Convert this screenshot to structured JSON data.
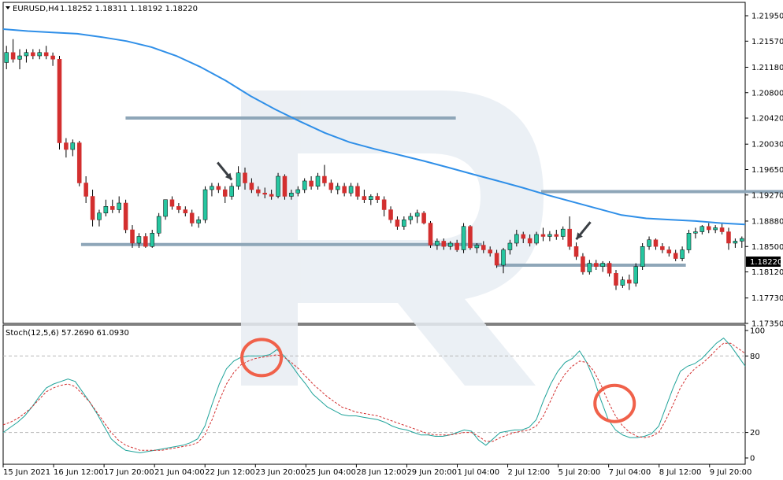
{
  "header": {
    "dropdown_icon": "triangle-down-icon",
    "symbol": "EURUSD,H4",
    "ohlc": "1.18252 1.18311 1.18192 1.18220"
  },
  "indicator_header": "Stoch(12,5,6) 57.2690 61.0930",
  "current_price_label": "1.18220",
  "colors": {
    "bull": "#26c6a0",
    "bear": "#d32f2f",
    "ma": "#2f8fe8",
    "level_line": "#8ea6b8",
    "stoch_main": "#1fa39a",
    "stoch_signal": "#d32f2f",
    "circle": "#f0614a",
    "arrow": "#3a3f44",
    "price_box": "#000000"
  },
  "chart_data": [
    {
      "type": "candlestick",
      "symbol": "EURUSD",
      "timeframe": "H4",
      "ylim": [
        1.1735,
        1.2215
      ],
      "y_ticks": [
        "1.21950",
        "1.21570",
        "1.21180",
        "1.20800",
        "1.20420",
        "1.20030",
        "1.19650",
        "1.19270",
        "1.18880",
        "1.18500",
        "1.18120",
        "1.17730",
        "1.17350"
      ],
      "x_ticks": [
        "15 Jun 2021",
        "16 Jun 12:00",
        "17 Jun 20:00",
        "21 Jun 04:00",
        "22 Jun 12:00",
        "23 Jun 20:00",
        "25 Jun 04:00",
        "28 Jun 12:00",
        "29 Jun 20:00",
        "1 Jul 04:00",
        "2 Jul 12:00",
        "5 Jul 20:00",
        "7 Jul 04:00",
        "8 Jul 12:00",
        "9 Jul 20:00"
      ],
      "candles": [
        [
          1.2125,
          1.215,
          1.2115,
          1.214
        ],
        [
          1.214,
          1.216,
          1.2125,
          1.213
        ],
        [
          1.213,
          1.2145,
          1.2115,
          1.2135
        ],
        [
          1.2135,
          1.2145,
          1.2125,
          1.214
        ],
        [
          1.214,
          1.2145,
          1.213,
          1.2135
        ],
        [
          1.2135,
          1.2145,
          1.213,
          1.214
        ],
        [
          1.214,
          1.215,
          1.213,
          1.2135
        ],
        [
          1.2135,
          1.214,
          1.212,
          1.213
        ],
        [
          1.213,
          1.2135,
          1.1995,
          1.2005
        ],
        [
          1.2005,
          1.2012,
          1.1983,
          1.1995
        ],
        [
          1.1995,
          1.201,
          1.1985,
          1.2005
        ],
        [
          1.2005,
          1.2008,
          1.194,
          1.1945
        ],
        [
          1.1945,
          1.1955,
          1.1915,
          1.1925
        ],
        [
          1.1925,
          1.1935,
          1.188,
          1.189
        ],
        [
          1.189,
          1.1905,
          1.188,
          1.19
        ],
        [
          1.19,
          1.192,
          1.1895,
          1.191
        ],
        [
          1.191,
          1.192,
          1.19,
          1.1905
        ],
        [
          1.1905,
          1.1925,
          1.19,
          1.1915
        ],
        [
          1.1915,
          1.192,
          1.187,
          1.1875
        ],
        [
          1.1875,
          1.1882,
          1.1848,
          1.1855
        ],
        [
          1.1855,
          1.187,
          1.1848,
          1.1865
        ],
        [
          1.1865,
          1.187,
          1.1848,
          1.185
        ],
        [
          1.185,
          1.1875,
          1.1848,
          1.187
        ],
        [
          1.187,
          1.19,
          1.1865,
          1.1895
        ],
        [
          1.1895,
          1.192,
          1.189,
          1.192
        ],
        [
          1.192,
          1.1925,
          1.1905,
          1.191
        ],
        [
          1.191,
          1.1915,
          1.19,
          1.1905
        ],
        [
          1.1905,
          1.191,
          1.1895,
          1.19
        ],
        [
          1.19,
          1.1905,
          1.188,
          1.1885
        ],
        [
          1.1885,
          1.1895,
          1.1878,
          1.189
        ],
        [
          1.189,
          1.194,
          1.1885,
          1.1935
        ],
        [
          1.1935,
          1.1945,
          1.1925,
          1.194
        ],
        [
          1.194,
          1.1945,
          1.193,
          1.1935
        ],
        [
          1.1935,
          1.194,
          1.1915,
          1.1925
        ],
        [
          1.1925,
          1.1945,
          1.192,
          1.194
        ],
        [
          1.194,
          1.197,
          1.1935,
          1.196
        ],
        [
          1.196,
          1.1968,
          1.1935,
          1.1945
        ],
        [
          1.1945,
          1.1952,
          1.193,
          1.1935
        ],
        [
          1.1935,
          1.194,
          1.1925,
          1.193
        ],
        [
          1.193,
          1.1938,
          1.1922,
          1.1928
        ],
        [
          1.1928,
          1.1935,
          1.192,
          1.1925
        ],
        [
          1.1925,
          1.196,
          1.1922,
          1.1955
        ],
        [
          1.1955,
          1.1958,
          1.192,
          1.1925
        ],
        [
          1.1925,
          1.1935,
          1.192,
          1.193
        ],
        [
          1.193,
          1.194,
          1.1925,
          1.1935
        ],
        [
          1.1935,
          1.1952,
          1.193,
          1.1948
        ],
        [
          1.1948,
          1.1955,
          1.1935,
          1.194
        ],
        [
          1.194,
          1.196,
          1.1935,
          1.1955
        ],
        [
          1.1955,
          1.1972,
          1.194,
          1.1945
        ],
        [
          1.1945,
          1.195,
          1.193,
          1.1935
        ],
        [
          1.1935,
          1.1945,
          1.1928,
          1.194
        ],
        [
          1.194,
          1.1945,
          1.1925,
          1.193
        ],
        [
          1.193,
          1.1945,
          1.1925,
          1.194
        ],
        [
          1.194,
          1.1945,
          1.192,
          1.1925
        ],
        [
          1.1925,
          1.1935,
          1.1915,
          1.192
        ],
        [
          1.192,
          1.1928,
          1.1912,
          1.1925
        ],
        [
          1.1925,
          1.193,
          1.1915,
          1.192
        ],
        [
          1.192,
          1.1925,
          1.1895,
          1.1905
        ],
        [
          1.1905,
          1.191,
          1.1885,
          1.189
        ],
        [
          1.189,
          1.1895,
          1.1875,
          1.188
        ],
        [
          1.188,
          1.1895,
          1.1875,
          1.189
        ],
        [
          1.189,
          1.19,
          1.1883,
          1.1895
        ],
        [
          1.1895,
          1.1905,
          1.1885,
          1.19
        ],
        [
          1.19,
          1.1903,
          1.1883,
          1.1885
        ],
        [
          1.1885,
          1.1888,
          1.1848,
          1.1852
        ],
        [
          1.1852,
          1.1862,
          1.1845,
          1.1858
        ],
        [
          1.1858,
          1.1862,
          1.1845,
          1.185
        ],
        [
          1.185,
          1.1858,
          1.1845,
          1.1855
        ],
        [
          1.1855,
          1.186,
          1.1842,
          1.1845
        ],
        [
          1.1845,
          1.1885,
          1.184,
          1.188
        ],
        [
          1.188,
          1.1882,
          1.1845,
          1.1848
        ],
        [
          1.1848,
          1.1855,
          1.184,
          1.1852
        ],
        [
          1.1852,
          1.1858,
          1.184,
          1.1845
        ],
        [
          1.1845,
          1.185,
          1.1835,
          1.184
        ],
        [
          1.184,
          1.1845,
          1.1818,
          1.1822
        ],
        [
          1.1822,
          1.1848,
          1.181,
          1.1845
        ],
        [
          1.1845,
          1.186,
          1.1838,
          1.1855
        ],
        [
          1.1855,
          1.1875,
          1.185,
          1.1868
        ],
        [
          1.1868,
          1.1872,
          1.1855,
          1.1862
        ],
        [
          1.1862,
          1.1868,
          1.185,
          1.1855
        ],
        [
          1.1855,
          1.1872,
          1.1852,
          1.1868
        ],
        [
          1.1868,
          1.1878,
          1.1858,
          1.1865
        ],
        [
          1.1865,
          1.1873,
          1.1858,
          1.1868
        ],
        [
          1.1868,
          1.1875,
          1.186,
          1.1865
        ],
        [
          1.1865,
          1.188,
          1.186,
          1.1876
        ],
        [
          1.1876,
          1.1895,
          1.1845,
          1.185
        ],
        [
          1.185,
          1.1856,
          1.183,
          1.1835
        ],
        [
          1.1835,
          1.184,
          1.1808,
          1.1812
        ],
        [
          1.1812,
          1.183,
          1.1808,
          1.1825
        ],
        [
          1.1825,
          1.183,
          1.1815,
          1.182
        ],
        [
          1.182,
          1.1828,
          1.1812,
          1.1825
        ],
        [
          1.1825,
          1.1828,
          1.1805,
          1.181
        ],
        [
          1.181,
          1.1815,
          1.1785,
          1.1792
        ],
        [
          1.1792,
          1.1805,
          1.1788,
          1.18
        ],
        [
          1.18,
          1.1808,
          1.1785,
          1.1795
        ],
        [
          1.1795,
          1.1825,
          1.179,
          1.182
        ],
        [
          1.182,
          1.1855,
          1.1815,
          1.185
        ],
        [
          1.185,
          1.1865,
          1.1845,
          1.186
        ],
        [
          1.186,
          1.1862,
          1.1845,
          1.185
        ],
        [
          1.185,
          1.1855,
          1.184,
          1.1845
        ],
        [
          1.1845,
          1.185,
          1.1835,
          1.184
        ],
        [
          1.184,
          1.1845,
          1.1828,
          1.1832
        ],
        [
          1.1832,
          1.185,
          1.1828,
          1.1845
        ],
        [
          1.1845,
          1.1875,
          1.184,
          1.187
        ],
        [
          1.187,
          1.1878,
          1.1862,
          1.1872
        ],
        [
          1.1872,
          1.1882,
          1.1868,
          1.188
        ],
        [
          1.188,
          1.1885,
          1.187,
          1.1875
        ],
        [
          1.1875,
          1.1882,
          1.187,
          1.1878
        ],
        [
          1.1878,
          1.1885,
          1.1868,
          1.1872
        ],
        [
          1.1872,
          1.1878,
          1.1845,
          1.1855
        ],
        [
          1.1855,
          1.1862,
          1.1848,
          1.1858
        ],
        [
          1.1858,
          1.1865,
          1.1848,
          1.1862
        ]
      ],
      "moving_average": [
        1.2175,
        1.2172,
        1.217,
        1.2168,
        1.2163,
        1.2157,
        1.2148,
        1.2135,
        1.2118,
        1.2098,
        1.2075,
        1.2055,
        1.2037,
        1.202,
        1.2006,
        1.1996,
        1.1987,
        1.1978,
        1.1968,
        1.1958,
        1.1948,
        1.1938,
        1.1927,
        1.1917,
        1.1907,
        1.1897,
        1.1892,
        1.189,
        1.1888,
        1.1885,
        1.1883
      ],
      "horizontal_levels": [
        {
          "value": 1.2042,
          "x_from": 0.165,
          "x_to": 0.61
        },
        {
          "value": 1.1932,
          "x_from": 0.725,
          "x_to": 1.0
        },
        {
          "value": 1.1853,
          "x_from": 0.105,
          "x_to": 0.645
        },
        {
          "value": 1.1822,
          "x_from": 0.665,
          "x_to": 0.92
        }
      ],
      "arrows_at_candle": [
        34,
        86
      ]
    },
    {
      "type": "line",
      "name": "Stoch(12,5,6)",
      "main": 57.269,
      "signal": 61.093,
      "ylim": [
        0,
        100
      ],
      "y_ticks": [
        "100",
        "80",
        "20",
        "0"
      ],
      "levels": [
        80,
        20
      ],
      "series": [
        {
          "values": [
            20,
            24,
            28,
            33,
            40,
            48,
            55,
            58,
            60,
            62,
            60,
            52,
            44,
            35,
            25,
            15,
            10,
            6,
            5,
            4,
            5,
            6,
            7,
            8,
            9,
            10,
            12,
            15,
            25,
            42,
            58,
            70,
            76,
            79,
            80,
            80,
            80,
            81,
            85,
            80,
            73,
            65,
            58,
            50,
            45,
            40,
            37,
            34,
            33,
            33,
            32,
            31,
            30,
            28,
            25,
            23,
            22,
            20,
            18,
            18,
            17,
            17,
            18,
            20,
            22,
            21,
            14,
            10,
            15,
            20,
            21,
            22,
            22,
            24,
            30,
            45,
            58,
            68,
            75,
            78,
            84,
            75,
            62,
            45,
            30,
            22,
            18,
            16,
            16,
            17,
            19,
            25,
            40,
            55,
            68,
            72,
            74,
            78,
            84,
            90,
            94,
            88,
            80,
            72
          ]
        },
        {
          "values": [
            26,
            28,
            31,
            35,
            40,
            46,
            52,
            55,
            57,
            58,
            56,
            50,
            44,
            36,
            28,
            20,
            14,
            10,
            8,
            6,
            6,
            6,
            6,
            7,
            8,
            9,
            10,
            12,
            18,
            30,
            45,
            58,
            67,
            73,
            76,
            78,
            79,
            80,
            81,
            79,
            75,
            70,
            64,
            58,
            53,
            48,
            44,
            40,
            38,
            36,
            35,
            34,
            33,
            31,
            29,
            27,
            25,
            23,
            21,
            19,
            18,
            18,
            18,
            19,
            20,
            20,
            17,
            13,
            13,
            16,
            18,
            20,
            21,
            22,
            25,
            33,
            45,
            57,
            66,
            72,
            76,
            75,
            68,
            57,
            44,
            33,
            25,
            20,
            17,
            16,
            17,
            20,
            30,
            42,
            55,
            64,
            70,
            74,
            79,
            85,
            90,
            90,
            86,
            82
          ]
        }
      ],
      "highlight_circles_at": [
        35,
        84
      ]
    }
  ]
}
